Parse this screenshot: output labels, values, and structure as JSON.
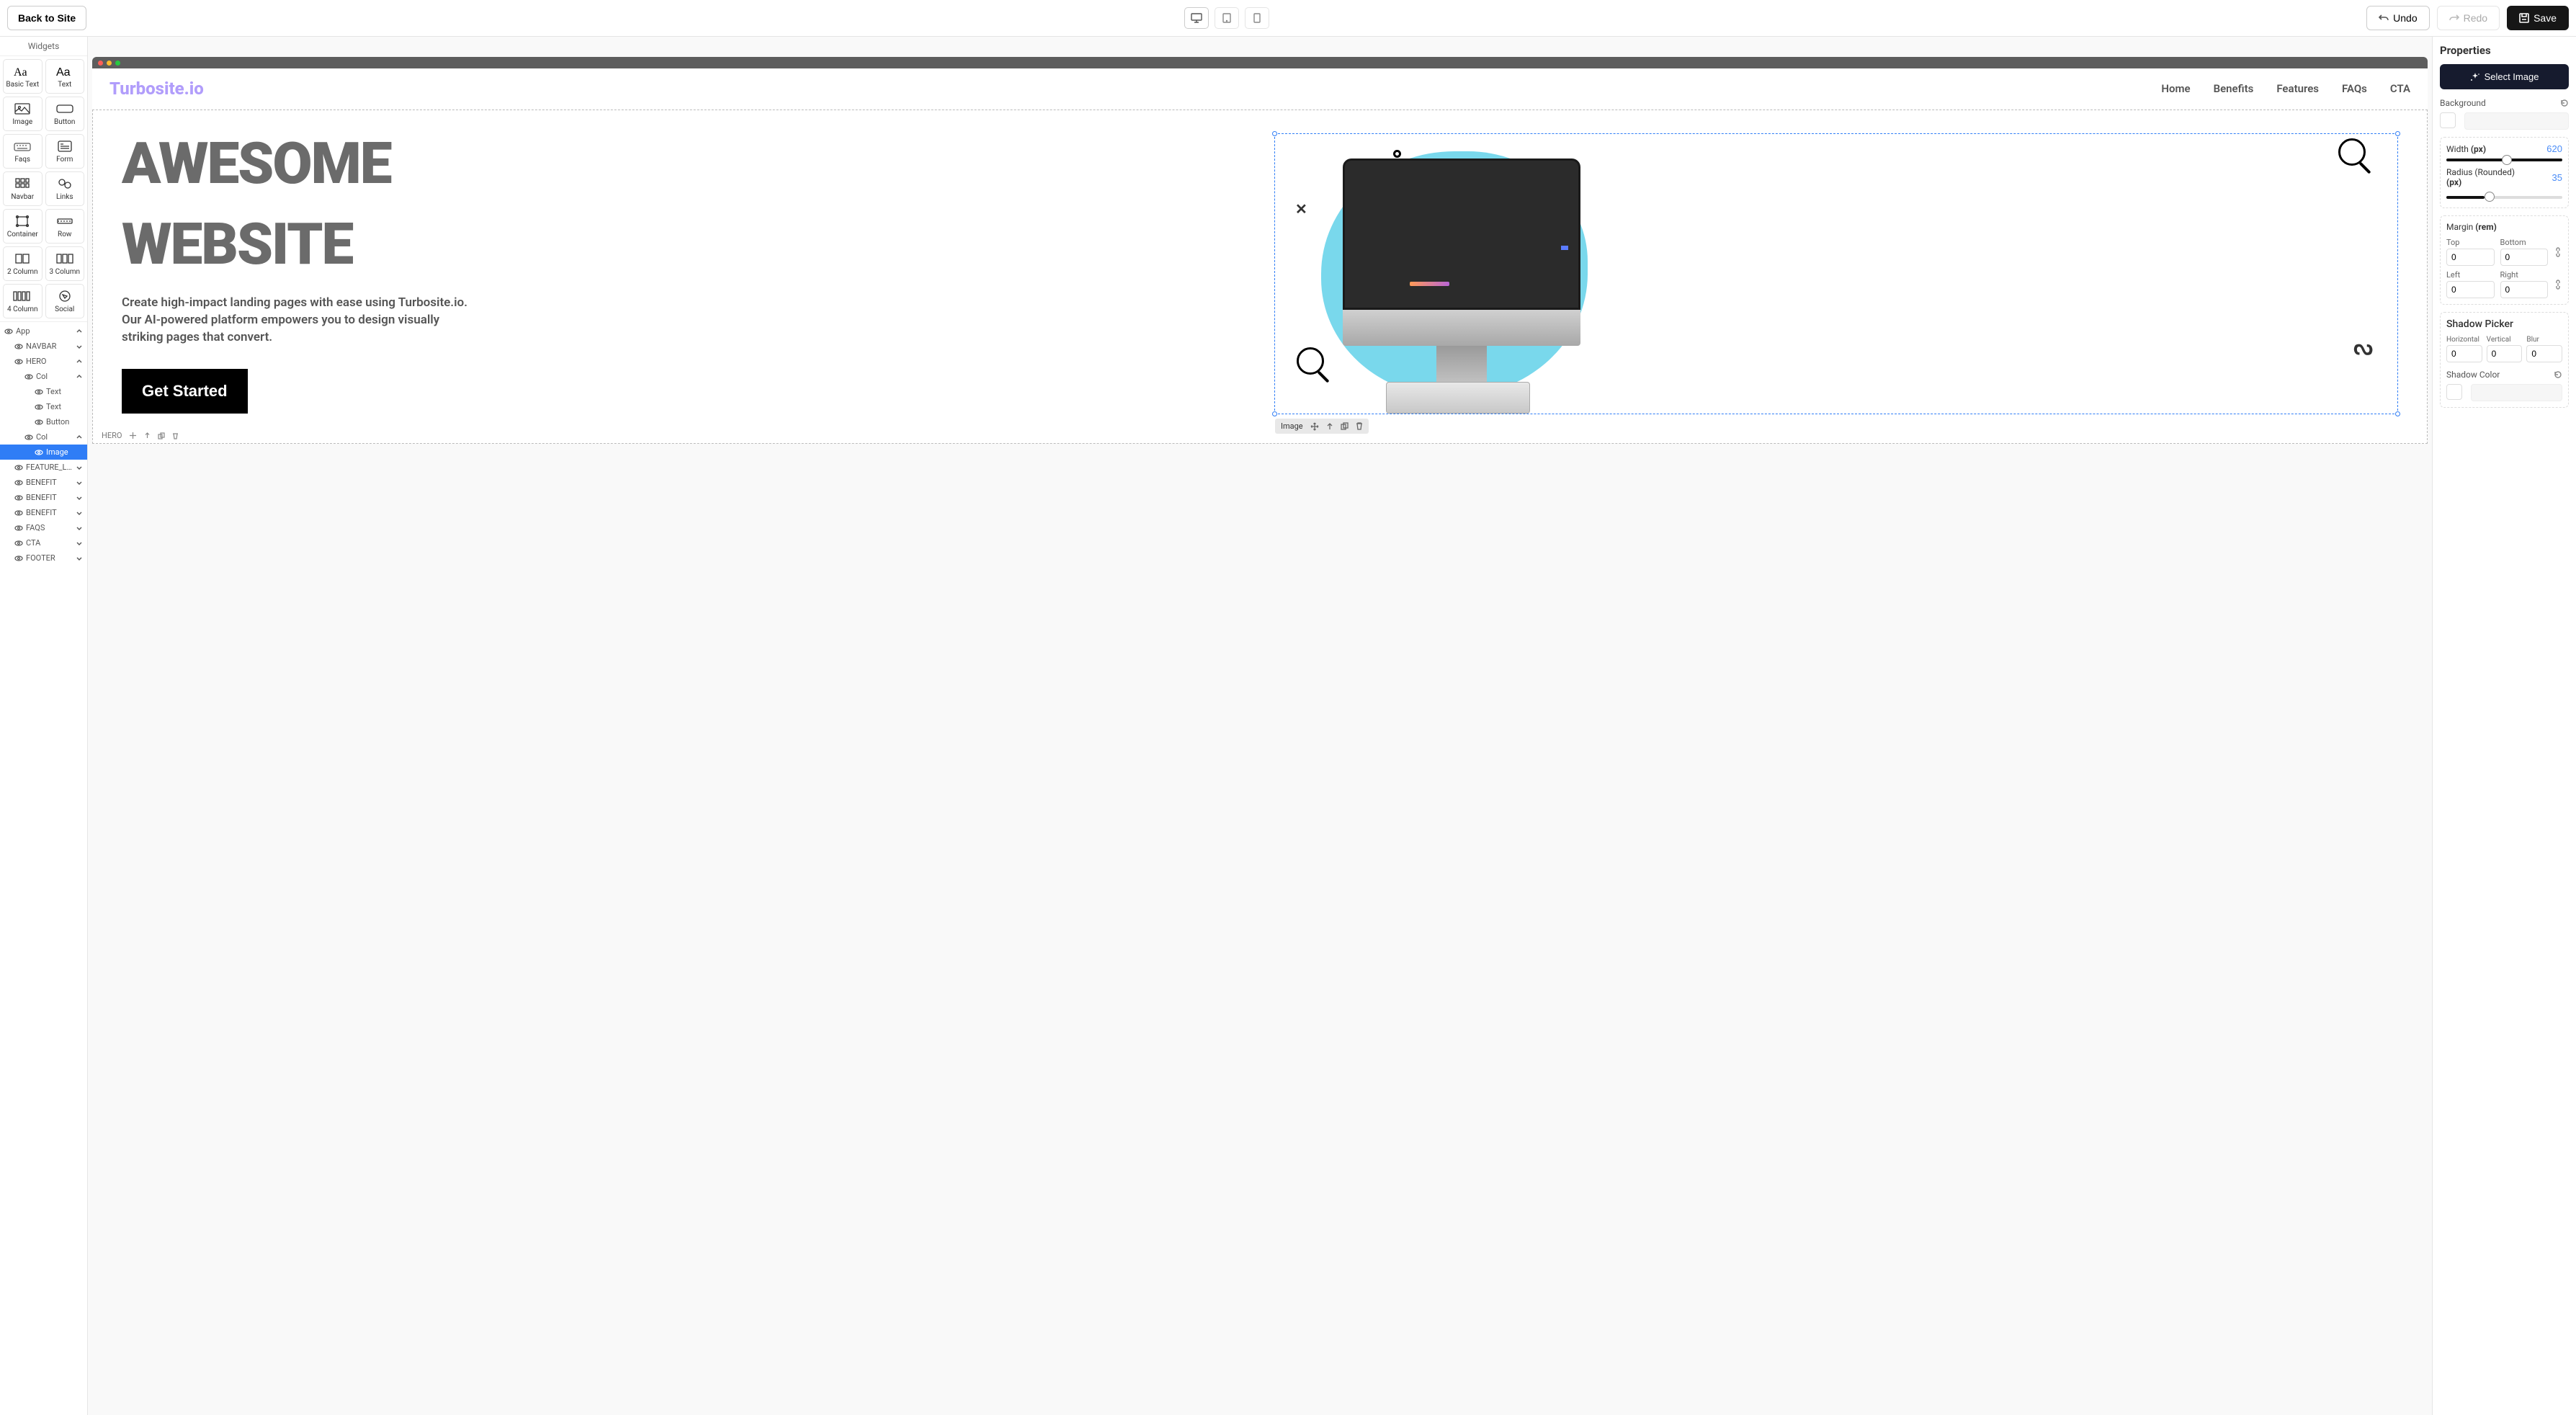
{
  "topbar": {
    "back": "Back to Site",
    "undo": "Undo",
    "redo": "Redo",
    "save": "Save"
  },
  "widgets": {
    "title": "Widgets",
    "items": [
      {
        "label": "Basic Text"
      },
      {
        "label": "Text"
      },
      {
        "label": "Image"
      },
      {
        "label": "Button"
      },
      {
        "label": "Faqs"
      },
      {
        "label": "Form"
      },
      {
        "label": "Navbar"
      },
      {
        "label": "Links"
      },
      {
        "label": "Container"
      },
      {
        "label": "Row"
      },
      {
        "label": "2 Column"
      },
      {
        "label": "3 Column"
      },
      {
        "label": "4 Column"
      },
      {
        "label": "Social"
      }
    ]
  },
  "layers": [
    {
      "label": "App",
      "indent": 0,
      "chev": "up"
    },
    {
      "label": "NAVBAR",
      "indent": 1,
      "chev": "down"
    },
    {
      "label": "HERO",
      "indent": 1,
      "chev": "up"
    },
    {
      "label": "Col",
      "indent": 2,
      "chev": "up"
    },
    {
      "label": "Text",
      "indent": 3
    },
    {
      "label": "Text",
      "indent": 3
    },
    {
      "label": "Button",
      "indent": 3
    },
    {
      "label": "Col",
      "indent": 2,
      "chev": "up"
    },
    {
      "label": "Image",
      "indent": 3,
      "active": true
    },
    {
      "label": "FEATURE_LISTS",
      "indent": 1,
      "chev": "down"
    },
    {
      "label": "BENEFIT",
      "indent": 1,
      "chev": "down"
    },
    {
      "label": "BENEFIT",
      "indent": 1,
      "chev": "down"
    },
    {
      "label": "BENEFIT",
      "indent": 1,
      "chev": "down"
    },
    {
      "label": "FAQS",
      "indent": 1,
      "chev": "down"
    },
    {
      "label": "CTA",
      "indent": 1,
      "chev": "down"
    },
    {
      "label": "FOOTER",
      "indent": 1,
      "chev": "down"
    }
  ],
  "site": {
    "logo": "Turbosite.io",
    "nav": [
      "Home",
      "Benefits",
      "Features",
      "FAQs",
      "CTA"
    ],
    "hero_title_1": "AWESOME",
    "hero_title_2": "WEBSITE",
    "hero_sub": "Create high-impact landing pages with ease using Turbosite.io. Our AI-powered platform empowers you to design visually striking pages that convert.",
    "hero_cta": "Get Started"
  },
  "selection": {
    "image_label": "Image",
    "hero_label": "HERO"
  },
  "properties": {
    "title": "Properties",
    "select_image": "Select Image",
    "background_label": "Background",
    "width_label": "Width",
    "width_unit": "(px)",
    "width_value": "620",
    "radius_label": "Radius (Rounded)",
    "radius_unit": "(px)",
    "radius_value": "35",
    "margin_label": "Margin",
    "margin_unit": "(rem)",
    "margin": {
      "top_label": "Top",
      "top": "0",
      "bottom_label": "Bottom",
      "bottom": "0",
      "left_label": "Left",
      "left": "0",
      "right_label": "Right",
      "right": "0"
    },
    "shadow_label": "Shadow Picker",
    "shadow": {
      "h_label": "Horizontal",
      "h": "0",
      "v_label": "Vertical",
      "v": "0",
      "b_label": "Blur",
      "b": "0"
    },
    "shadow_color_label": "Shadow Color"
  }
}
